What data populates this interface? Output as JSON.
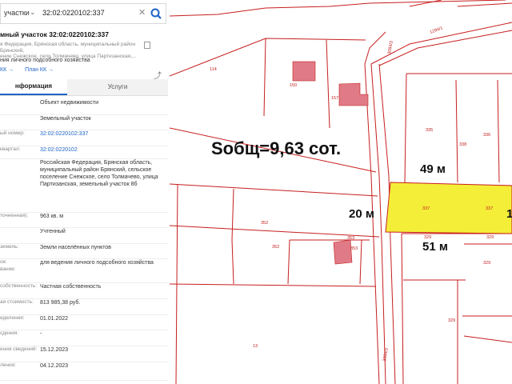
{
  "search": {
    "category": "участки",
    "query": "32:02:0220102:337"
  },
  "object": {
    "title": "мный участок 32:02:0220102:337",
    "address_line1": "я Федерация, Брянская область, муниципальный район Брянский,",
    "address_line2": "ение Снежское, село Толмачево, улица Партизанская,...",
    "purpose": "ния личного подсобного хозяйства",
    "link_plan": "План КК →"
  },
  "tabs": {
    "info": "нформация",
    "services": "Услуги"
  },
  "rows": [
    {
      "k": "",
      "v": "Объект недвижимости"
    },
    {
      "k": "",
      "v": "Земельный участок"
    },
    {
      "k": "ый номер:",
      "v": "32:02:0220102:337"
    },
    {
      "k": "квартал:",
      "v": "32:02:0220102"
    },
    {
      "k": "",
      "v": "Российская Федерация, Брянская область, муниципальный район Брянский, сельское поселение Снежское, село Толмачево, улица Партизанская, земельный участок 8б"
    },
    {
      "k": "точненная):",
      "v": "963 кв. м"
    },
    {
      "k": "",
      "v": "Учтенный"
    },
    {
      "k": "земель:",
      "v": "Земли населённых пунктов"
    },
    {
      "k": "ое",
      "k2": "вание:",
      "v": "для ведения личного подсобного хозяйства"
    },
    {
      "k": "собственность:",
      "v": "Частная собственность"
    },
    {
      "k": "ая стоимость:",
      "v": "813 985,38 руб."
    },
    {
      "k": "еделения:",
      "v": "01.01.2022"
    },
    {
      "k": "сдения:",
      "v": "-"
    },
    {
      "k": "ения сведений:",
      "v": "15.12.2023"
    },
    {
      "k": "ления:",
      "v": "04.12.2023"
    }
  ],
  "map": {
    "area_text": "Sобщ=9,63 сот.",
    "dim_top": "49 м",
    "dim_left": "20 м",
    "dim_bottom": "51 м",
    "dim_right": "1",
    "parcels": [
      "114",
      "150",
      "157",
      "335",
      "336",
      "338",
      "337",
      "337",
      "352",
      "352",
      "353",
      "353",
      "329",
      "329",
      "329",
      "329",
      "13",
      "3084/3",
      "3084/3",
      "1294/1"
    ],
    "colors": {
      "highlight": "#f4ee38",
      "boundary": "#c81e1e",
      "building": "#e07a86"
    }
  }
}
